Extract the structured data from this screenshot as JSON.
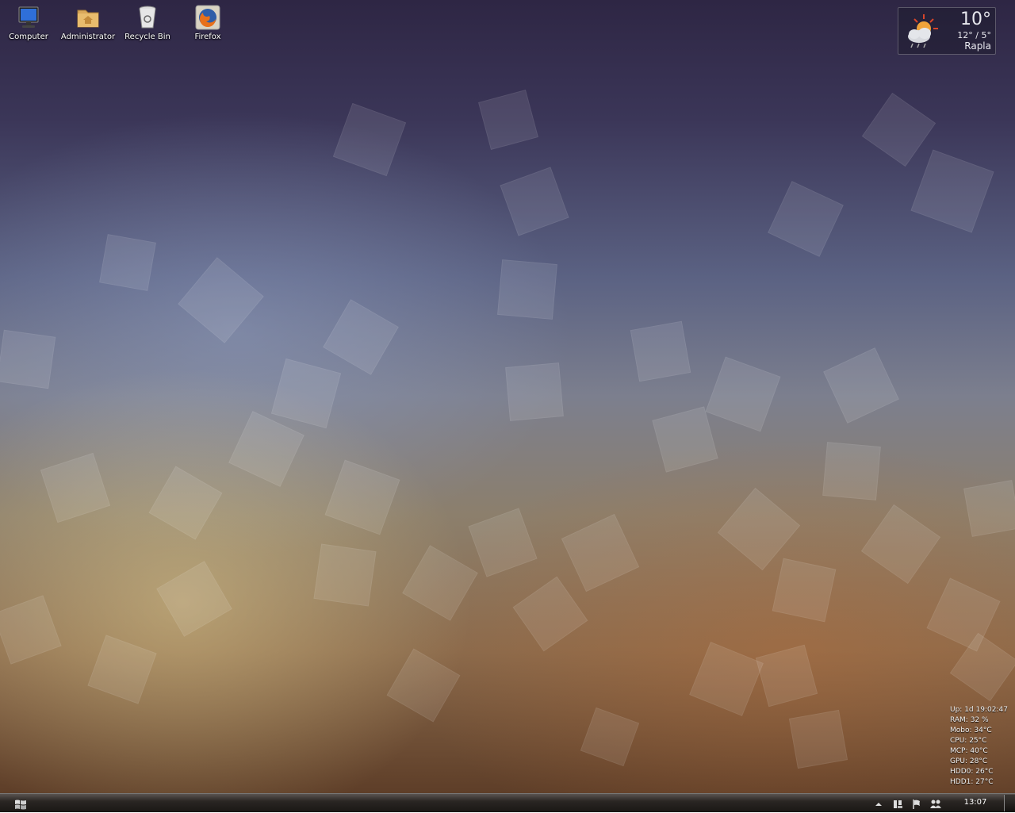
{
  "desktop": {
    "icons": [
      {
        "label": "Computer",
        "icon": "computer-icon"
      },
      {
        "label": "Administrator",
        "icon": "user-folder-icon"
      },
      {
        "label": "Recycle Bin",
        "icon": "recycle-bin-icon"
      },
      {
        "label": "Firefox",
        "icon": "firefox-icon"
      }
    ]
  },
  "weather": {
    "temperature": "10°",
    "range": "12° / 5°",
    "city": "Rapla",
    "icon": "partly-cloudy-icon"
  },
  "system_stats": [
    "Up: 1d 19:02:47",
    "RAM: 32 %",
    "Mobo: 34°C",
    "CPU: 25°C",
    "MCP: 40°C",
    "GPU: 28°C",
    "HDD0: 26°C",
    "HDD1: 27°C"
  ],
  "taskbar": {
    "start_icon": "windows-logo-icon",
    "tray_icons": [
      "show-hidden-icons-arrow",
      "network-icon",
      "flag-icon",
      "users-icon"
    ],
    "clock": "13:07"
  },
  "colors": {
    "taskbar": "#1a1715",
    "wallpaper_top": "#2e2644",
    "wallpaper_bottom": "#5e3e28"
  }
}
